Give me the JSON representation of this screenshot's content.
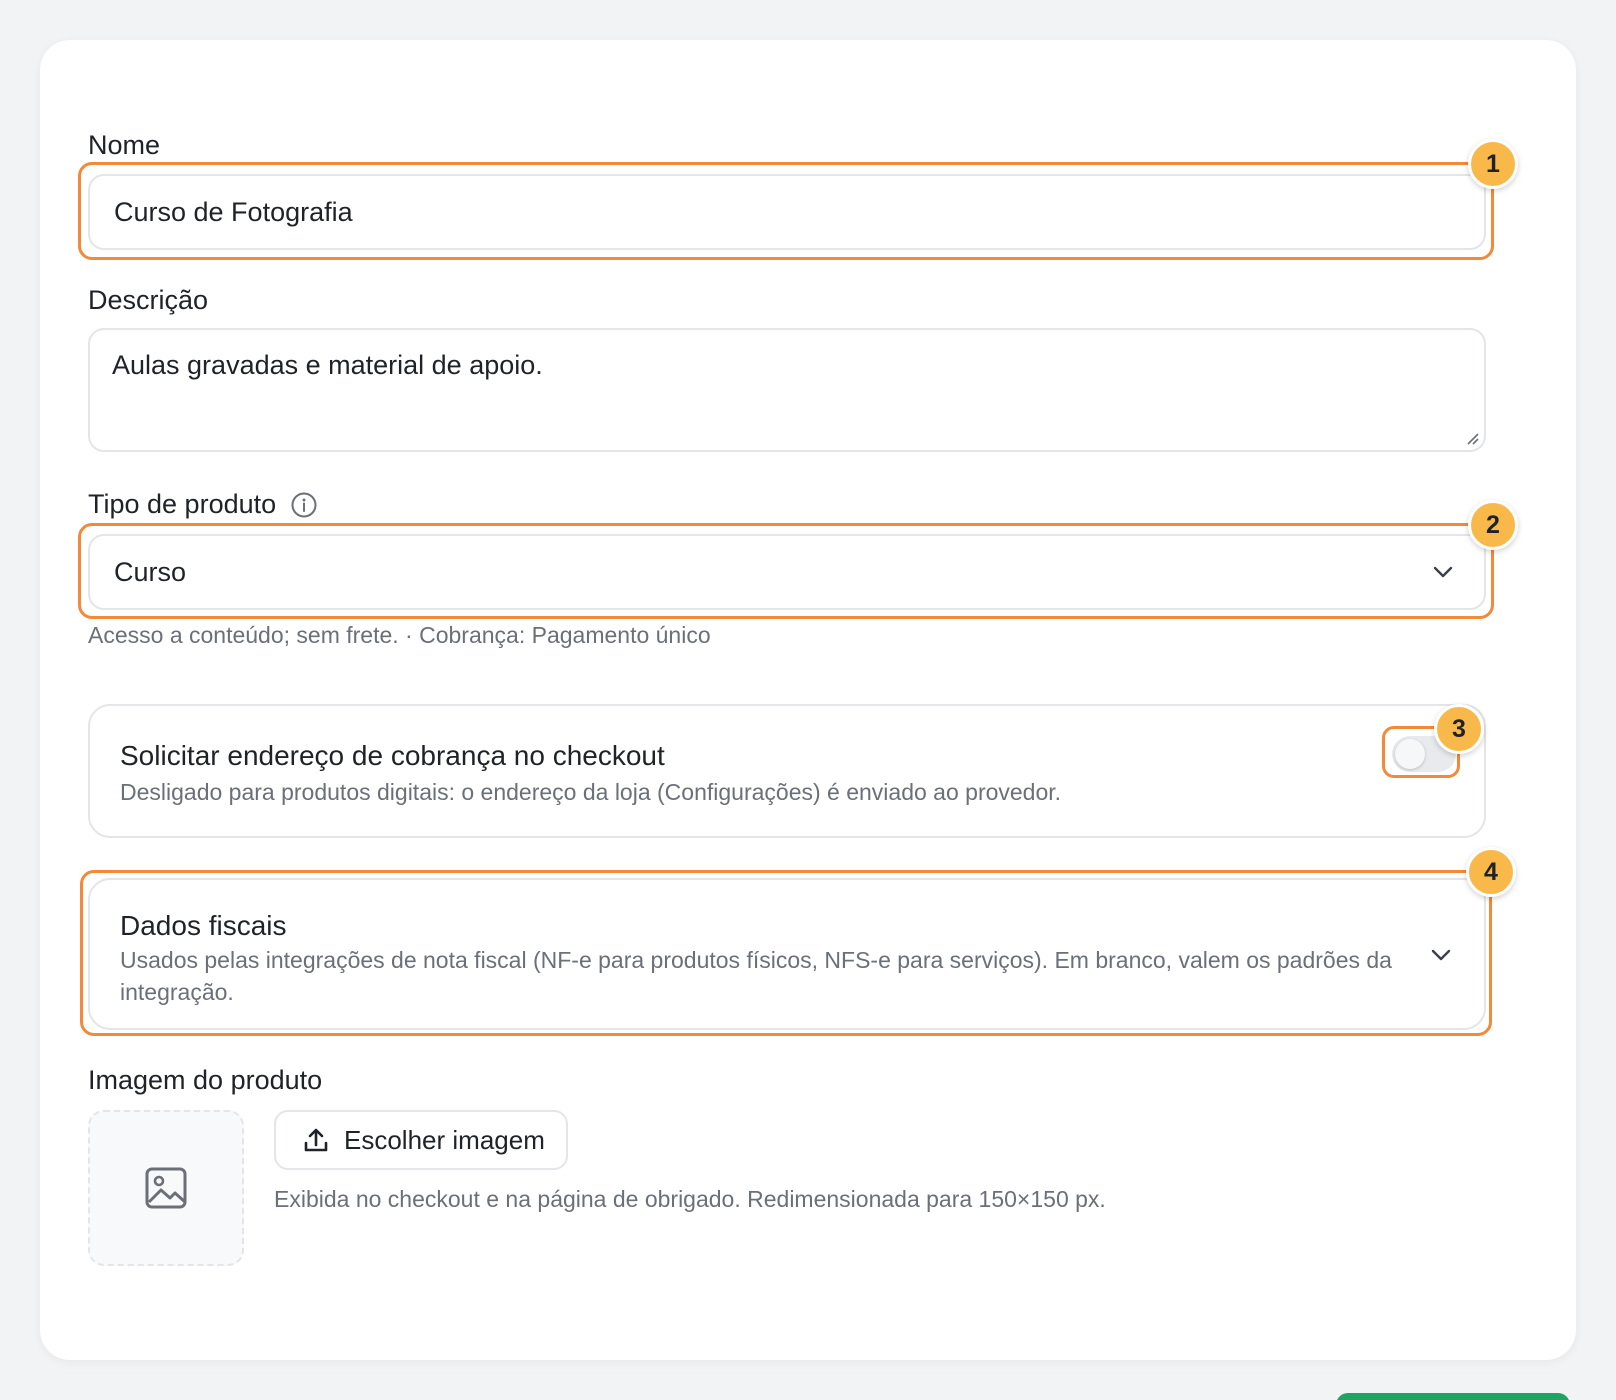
{
  "form": {
    "name": {
      "label": "Nome",
      "value": "Curso de Fotografia",
      "badge": "1"
    },
    "description": {
      "label": "Descrição",
      "value": "Aulas gravadas e material de apoio."
    },
    "product_type": {
      "label": "Tipo de produto",
      "value": "Curso",
      "helper": "Acesso a conteúdo; sem frete. · Cobrança: Pagamento único",
      "badge": "2"
    },
    "billing_address": {
      "title": "Solicitar endereço de cobrança no checkout",
      "subtitle": "Desligado para produtos digitais: o endereço da loja (Configurações) é enviado ao provedor.",
      "enabled": false,
      "badge": "3"
    },
    "fiscal": {
      "title": "Dados fiscais",
      "subtitle": "Usados pelas integrações de nota fiscal (NF-e para produtos físicos, NFS-e para serviços). Em branco, valem os padrões da integração.",
      "expanded": false,
      "badge": "4"
    },
    "image": {
      "label": "Imagem do produto",
      "button_label": "Escolher imagem",
      "helper": "Exibida no checkout e na página de obrigado. Redimensionada para 150×150 px."
    }
  },
  "colors": {
    "highlight": "#f28a3a",
    "badge": "#f9b84a",
    "primary_button": "#1fa463"
  },
  "icons": [
    "info-icon",
    "chevron-down-icon",
    "upload-icon",
    "image-placeholder-icon",
    "resize-handle-icon"
  ]
}
